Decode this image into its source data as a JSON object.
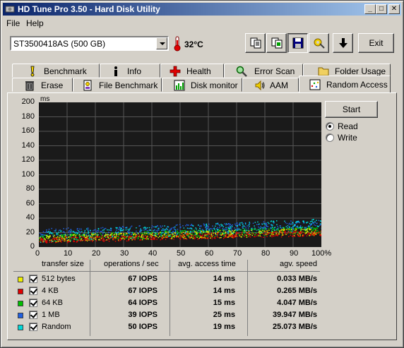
{
  "window": {
    "title": "HD Tune Pro 3.50 - Hard Disk Utility"
  },
  "menu": {
    "file": "File",
    "help": "Help"
  },
  "toolbar": {
    "drive": "ST3500418AS (500 GB)",
    "temperature": "32°C",
    "exit_label": "Exit"
  },
  "tabs_row1": [
    {
      "label": "Benchmark",
      "icon": "exclamation-icon"
    },
    {
      "label": "Info",
      "icon": "info-icon"
    },
    {
      "label": "Health",
      "icon": "health-cross-icon"
    },
    {
      "label": "Error Scan",
      "icon": "magnifier-icon"
    },
    {
      "label": "Folder Usage",
      "icon": "folder-icon"
    }
  ],
  "tabs_row2": [
    {
      "label": "Erase",
      "icon": "trash-icon"
    },
    {
      "label": "File Benchmark",
      "icon": "file-benchmark-icon"
    },
    {
      "label": "Disk monitor",
      "icon": "disk-monitor-icon"
    },
    {
      "label": "AAM",
      "icon": "speaker-icon"
    },
    {
      "label": "Random Access",
      "icon": "random-access-icon"
    }
  ],
  "controls": {
    "start_label": "Start",
    "read_label": "Read",
    "write_label": "Write",
    "selected_mode": "read"
  },
  "chart_data": {
    "type": "scatter",
    "ylabel": "ms",
    "ylim": [
      0,
      200
    ],
    "xlim": [
      0,
      100
    ],
    "y_ticks": [
      "200",
      "180",
      "160",
      "140",
      "120",
      "100",
      "80",
      "60",
      "40",
      "20",
      "0"
    ],
    "x_ticks": [
      "0",
      "10",
      "20",
      "30",
      "40",
      "50",
      "60",
      "70",
      "80",
      "90",
      "100%"
    ],
    "grid": true,
    "series": [
      {
        "name": "512 bytes",
        "color": "#e8e800",
        "y_start": 12,
        "y_end": 22,
        "spread": 5
      },
      {
        "name": "4 KB",
        "color": "#e80000",
        "y_start": 10,
        "y_end": 20,
        "spread": 4
      },
      {
        "name": "64 KB",
        "color": "#00c000",
        "y_start": 13,
        "y_end": 24,
        "spread": 5
      },
      {
        "name": "1 MB",
        "color": "#2060e0",
        "y_start": 20,
        "y_end": 32,
        "spread": 6
      },
      {
        "name": "Random",
        "color": "#00d8d8",
        "y_start": 15,
        "y_end": 32,
        "spread": 8
      }
    ]
  },
  "results": {
    "headers": {
      "transfer_size": "transfer size",
      "ops": "operations / sec",
      "access": "avg. access time",
      "speed": "agv. speed"
    },
    "rows": [
      {
        "size": "512 bytes",
        "ops": "67 IOPS",
        "access": "14 ms",
        "speed": "0.033 MB/s",
        "color": "#f0f000"
      },
      {
        "size": "4 KB",
        "ops": "67 IOPS",
        "access": "14 ms",
        "speed": "0.265 MB/s",
        "color": "#e00000"
      },
      {
        "size": "64 KB",
        "ops": "64 IOPS",
        "access": "15 ms",
        "speed": "4.047 MB/s",
        "color": "#00c000"
      },
      {
        "size": "1 MB",
        "ops": "39 IOPS",
        "access": "25 ms",
        "speed": "39.947 MB/s",
        "color": "#2060e0"
      },
      {
        "size": "Random",
        "ops": "50 IOPS",
        "access": "19 ms",
        "speed": "25.073 MB/s",
        "color": "#00d8d8"
      }
    ]
  }
}
